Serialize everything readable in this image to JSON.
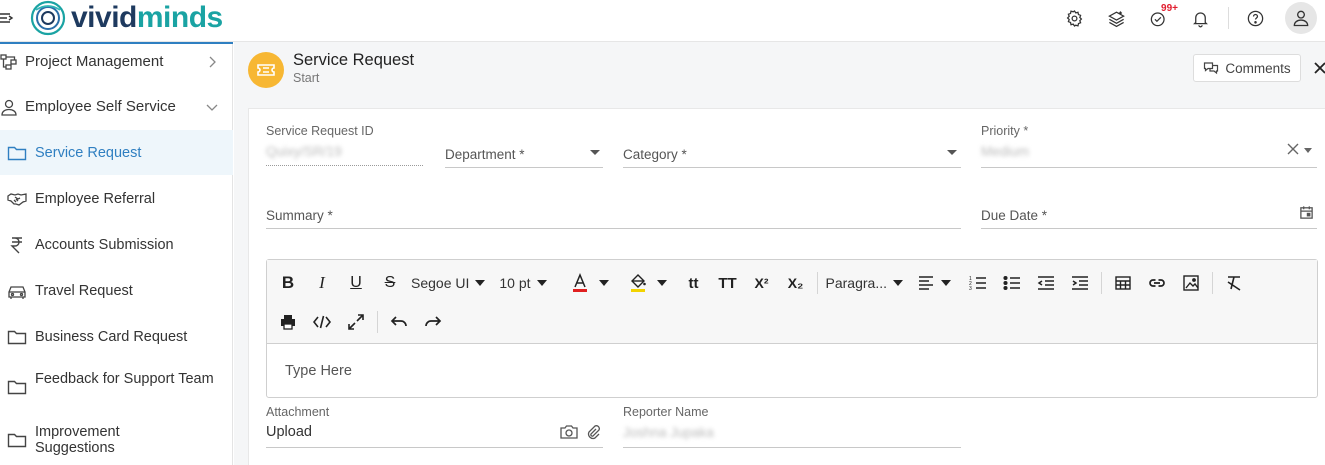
{
  "brand": {
    "name_part1": "vivid",
    "name_part2": "minds"
  },
  "header": {
    "notifications_badge": "99+"
  },
  "sidebar": {
    "groups": [
      {
        "label": "Project Management"
      },
      {
        "label": "Employee Self Service"
      }
    ],
    "items": [
      {
        "label": "Service Request",
        "icon": "folder-icon"
      },
      {
        "label": "Employee Referral",
        "icon": "handshake-icon"
      },
      {
        "label": "Accounts Submission",
        "icon": "rupee-icon"
      },
      {
        "label": "Travel Request",
        "icon": "car-icon"
      },
      {
        "label": "Business Card Request",
        "icon": "folder-icon"
      },
      {
        "label": "Feedback for Support Team",
        "icon": "folder-icon"
      },
      {
        "label": "Improvement Suggestions",
        "icon": "folder-icon"
      }
    ]
  },
  "page": {
    "title": "Service Request",
    "subtitle": "Start",
    "comments_label": "Comments"
  },
  "form": {
    "service_request_id": {
      "label": "Service Request ID",
      "value": "Quixy/SR/19"
    },
    "department": {
      "label": "Department *"
    },
    "category": {
      "label": "Category *"
    },
    "priority": {
      "label": "Priority *",
      "value": "Medium"
    },
    "summary": {
      "label": "Summary *"
    },
    "due_date": {
      "label": "Due Date *"
    },
    "attachment": {
      "label": "Attachment",
      "value": "Upload"
    },
    "reporter": {
      "label": "Reporter Name",
      "value": "Joshna Jupaka"
    }
  },
  "editor": {
    "font_family": "Segoe UI",
    "font_size": "10 pt",
    "block_format": "Paragra...",
    "placeholder": "Type Here"
  }
}
